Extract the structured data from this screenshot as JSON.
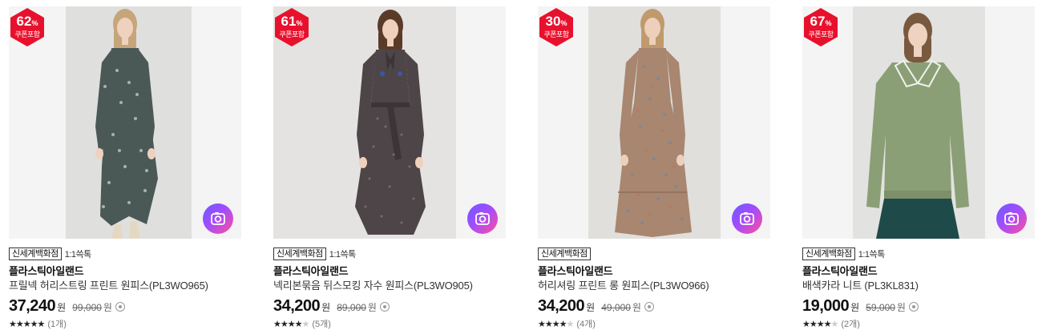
{
  "products": [
    {
      "discount": "62",
      "percent_sign": "%",
      "coupon_label": "쿠폰포함",
      "store": "신세계백화점",
      "chat": "1:1쓱톡",
      "brand": "플라스틱아일랜드",
      "name": "프릴넥 허리스트링 프린트 원피스(PL3WO965)",
      "price": "37,240",
      "price_unit": "원",
      "original_price": "99,000",
      "original_unit": "원",
      "rating_stars": 5,
      "review_count": "(1개)",
      "icons": [
        "discount-badge-icon",
        "camera-icon",
        "info-icon",
        "star-icon"
      ]
    },
    {
      "discount": "61",
      "percent_sign": "%",
      "coupon_label": "쿠폰포함",
      "store": "신세계백화점",
      "chat": "1:1쓱톡",
      "brand": "플라스틱아일랜드",
      "name": "넥리본묶음 뒤스모킹 자수 원피스(PL3WO905)",
      "price": "34,200",
      "price_unit": "원",
      "original_price": "89,000",
      "original_unit": "원",
      "rating_stars": 4.5,
      "review_count": "(5개)",
      "icons": [
        "discount-badge-icon",
        "camera-icon",
        "info-icon",
        "star-icon"
      ]
    },
    {
      "discount": "30",
      "percent_sign": "%",
      "coupon_label": "쿠폰포함",
      "store": "신세계백화점",
      "chat": "",
      "brand": "플라스틱아일랜드",
      "name": "허리셔링 프린트 롱 원피스(PL3WO966)",
      "price": "34,200",
      "price_unit": "원",
      "original_price": "49,000",
      "original_unit": "원",
      "rating_stars": 4,
      "review_count": "(4개)",
      "icons": [
        "discount-badge-icon",
        "camera-icon",
        "info-icon",
        "star-icon"
      ]
    },
    {
      "discount": "67",
      "percent_sign": "%",
      "coupon_label": "쿠폰포함",
      "store": "신세계백화점",
      "chat": "1:1쓱톡",
      "brand": "플라스틱아일랜드",
      "name": "배색카라 니트 (PL3KL831)",
      "price": "19,000",
      "price_unit": "원",
      "original_price": "59,000",
      "original_unit": "원",
      "rating_stars": 4.5,
      "review_count": "(2개)",
      "icons": [
        "discount-badge-icon",
        "camera-icon",
        "info-icon",
        "star-icon"
      ]
    }
  ],
  "colors": {
    "badge_red": "#e8112d",
    "camera_gradient_start": "#6a5cff",
    "camera_gradient_end": "#ff4f9a"
  }
}
